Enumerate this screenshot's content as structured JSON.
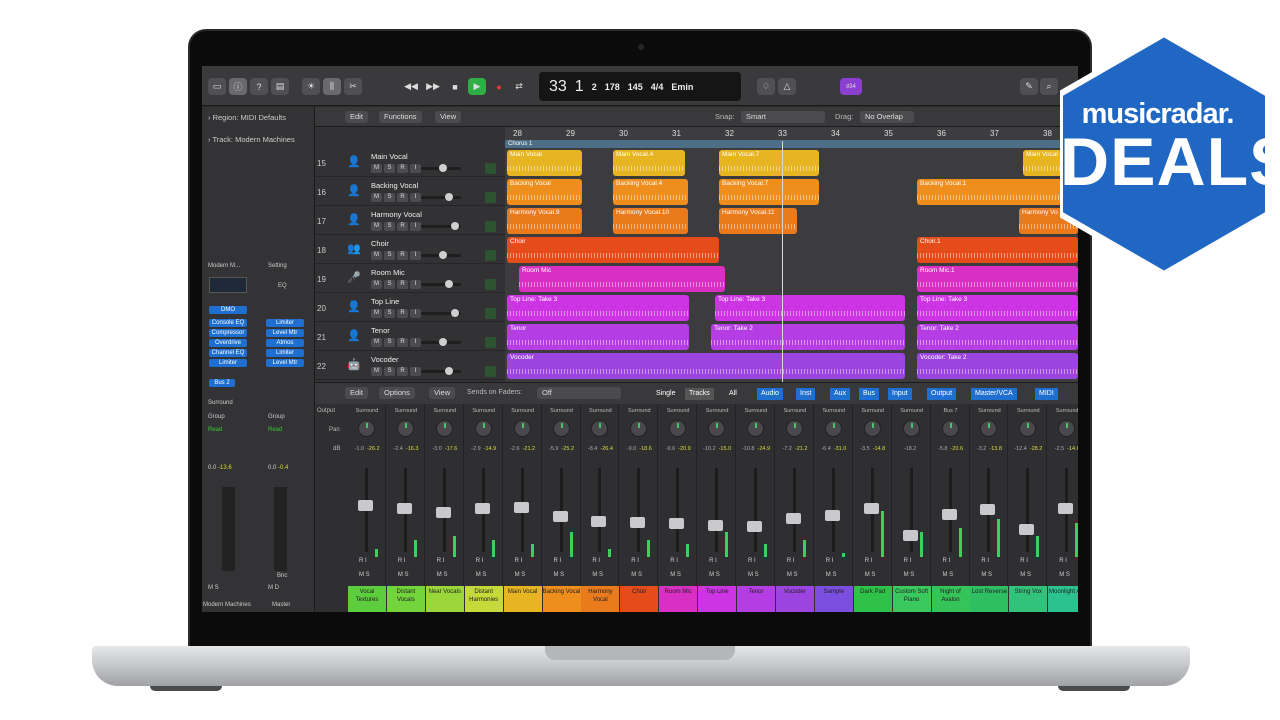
{
  "brand": {
    "site": "musicradar.",
    "label": "DEALS",
    "badge_color": "#1f67c3"
  },
  "lcd": {
    "bar": "33",
    "beat": "1",
    "div": "2",
    "tick": "178",
    "bar_lbl": "BAR",
    "beat_lbl": "BEAT",
    "div_lbl": "DIV",
    "tick_lbl": "TICK",
    "tempo": "145",
    "keep": "KEEP",
    "tempo_lbl": "TEMPO",
    "sig_top": "4",
    "sig_bot": "4",
    "time_lbl": "TIME",
    "key": "Emin",
    "key_lbl": "KEY"
  },
  "toolbar": {
    "lcd_badge": "♯34"
  },
  "inspector": {
    "region": "Region: MIDI Defaults",
    "track": "Track: Modern Machines",
    "preset": "Modern M...",
    "setting": "Setting",
    "eq": "EQ",
    "dmo": "DMO",
    "plugins_a": [
      "Console EQ",
      "Compressor",
      "Overdrive",
      "Channel EQ",
      "Limiter"
    ],
    "plugins_b": [
      "Limiter",
      "Level Mtr",
      "Atmos",
      "Limiter",
      "Level Mtr"
    ],
    "bus": "Bus 2",
    "surround": "Surround",
    "group": "Group",
    "read": "Read",
    "vals_a": [
      "0.0",
      "-13.6"
    ],
    "vals_b": [
      "0.0",
      "-0.4"
    ],
    "bnc": "Bnc",
    "names": [
      "Modern Machines",
      "Master"
    ],
    "ms": [
      "M",
      "S",
      "M",
      "D"
    ]
  },
  "tracks_header": {
    "edit": "Edit",
    "functions": "Functions",
    "view": "View",
    "snap_label": "Snap:",
    "snap": "Smart",
    "drag_label": "Drag:",
    "drag": "No Overlap"
  },
  "ruler": [
    "28",
    "29",
    "30",
    "31",
    "32",
    "33",
    "34",
    "35",
    "36",
    "37",
    "38"
  ],
  "marker": "Chorus 1",
  "tracks": [
    {
      "num": "15",
      "name": "Main Vocal",
      "icon": "👤",
      "color": "#e7b521"
    },
    {
      "num": "16",
      "name": "Backing Vocal",
      "icon": "👤",
      "color": "#ee8e1d"
    },
    {
      "num": "17",
      "name": "Harmony Vocal",
      "icon": "👤",
      "color": "#ea7b1c"
    },
    {
      "num": "18",
      "name": "Choir",
      "icon": "👥",
      "color": "#e64c1a"
    },
    {
      "num": "19",
      "name": "Room Mic",
      "icon": "🎤",
      "color": "#d92fc2"
    },
    {
      "num": "20",
      "name": "Top Line",
      "icon": "👤",
      "color": "#cc34e4"
    },
    {
      "num": "21",
      "name": "Tenor",
      "icon": "👤",
      "color": "#b43ee3"
    },
    {
      "num": "22",
      "name": "Vocoder",
      "icon": "🤖",
      "color": "#9b44e0"
    }
  ],
  "regions": [
    {
      "row": 0,
      "name": "Main Vocal",
      "color": "#e7b521"
    },
    {
      "row": 0,
      "name": "Main Vocal.4",
      "color": "#e7b521"
    },
    {
      "row": 0,
      "name": "Main Vocal.7",
      "color": "#e7b521"
    },
    {
      "row": 0,
      "name": "Main Vocal",
      "color": "#e7b521"
    },
    {
      "row": 1,
      "name": "Backing Vocal",
      "color": "#ee8e1d"
    },
    {
      "row": 1,
      "name": "Backing Vocal.4",
      "color": "#ee8e1d"
    },
    {
      "row": 1,
      "name": "Backing Vocal.7",
      "color": "#ee8e1d"
    },
    {
      "row": 1,
      "name": "Backing Vocal.1",
      "color": "#ee8e1d"
    },
    {
      "row": 2,
      "name": "Harmony Vocal.9",
      "color": "#ea7b1c"
    },
    {
      "row": 2,
      "name": "Harmony Vocal.10",
      "color": "#ea7b1c"
    },
    {
      "row": 2,
      "name": "Harmony Vocal.11",
      "color": "#ea7b1c"
    },
    {
      "row": 2,
      "name": "Harmony Vo",
      "color": "#ea7b1c"
    },
    {
      "row": 3,
      "name": "Choir",
      "color": "#e64c1a"
    },
    {
      "row": 3,
      "name": "Choir.1",
      "color": "#e64c1a"
    },
    {
      "row": 4,
      "name": "Room Mic",
      "color": "#d92fc2"
    },
    {
      "row": 4,
      "name": "Room Mic.1",
      "color": "#d92fc2"
    },
    {
      "row": 5,
      "name": "Top Line: Take 3",
      "color": "#cc34e4"
    },
    {
      "row": 5,
      "name": "Top Line: Take 3",
      "color": "#cc34e4"
    },
    {
      "row": 5,
      "name": "Top Line: Take 3",
      "color": "#cc34e4"
    },
    {
      "row": 6,
      "name": "Tenor",
      "color": "#b43ee3"
    },
    {
      "row": 6,
      "name": "Tenor: Take 2",
      "color": "#b43ee3"
    },
    {
      "row": 6,
      "name": "Tenor: Take 2",
      "color": "#b43ee3"
    },
    {
      "row": 7,
      "name": "Vocoder",
      "color": "#9b44e0"
    },
    {
      "row": 7,
      "name": "Vocoder: Take 2",
      "color": "#9b44e0"
    }
  ],
  "mixer_header": {
    "edit": "Edit",
    "options": "Options",
    "view": "View",
    "sends": "Sends on Faders:",
    "off": "Off",
    "single": "Single",
    "tracks": "Tracks",
    "all": "All",
    "filters": [
      "Audio",
      "Inst",
      "Aux",
      "Bus",
      "Input",
      "Output",
      "Master/VCA",
      "MIDI"
    ],
    "output_lbl": "Output",
    "pan_lbl": "Pan",
    "db_lbl": "dB"
  },
  "channels": [
    {
      "out": "Surround",
      "db": "-1.0",
      "peak": "-26.2",
      "name": "Vocal Textures",
      "color": "#5ccd3c",
      "level": 0.45,
      "meter": 0.1
    },
    {
      "out": "Surround",
      "db": "-2.4",
      "peak": "-16.3",
      "name": "Distant Vocals",
      "color": "#74d43b",
      "level": 0.5,
      "meter": 0.2
    },
    {
      "out": "Surround",
      "db": "-3.0",
      "peak": "-17.6",
      "name": "Near Vocals",
      "color": "#9bd63a",
      "level": 0.55,
      "meter": 0.25
    },
    {
      "out": "Surround",
      "db": "-2.9",
      "peak": "-14.9",
      "name": "Distant Harmonies",
      "color": "#c6d93a",
      "level": 0.5,
      "meter": 0.2
    },
    {
      "out": "Surround",
      "db": "-2.6",
      "peak": "-21.2",
      "name": "Main Vocal",
      "color": "#e7b521",
      "level": 0.48,
      "meter": 0.15
    },
    {
      "out": "Surround",
      "db": "-5.9",
      "peak": "-25.2",
      "name": "Backing Vocal",
      "color": "#ee8e1d",
      "level": 0.62,
      "meter": 0.3
    },
    {
      "out": "Surround",
      "db": "-8.4",
      "peak": "-26.4",
      "name": "Harmony Vocal",
      "color": "#ea7b1c",
      "level": 0.68,
      "meter": 0.1
    },
    {
      "out": "Surround",
      "db": "-9.0",
      "peak": "-18.6",
      "name": "Choir",
      "color": "#e64c1a",
      "level": 0.7,
      "meter": 0.2
    },
    {
      "out": "Surround",
      "db": "-9.6",
      "peak": "-20.9",
      "name": "Room Mic",
      "color": "#d92fc2",
      "level": 0.72,
      "meter": 0.15
    },
    {
      "out": "Surround",
      "db": "-10.2",
      "peak": "-15.0",
      "name": "Top Line",
      "color": "#cc34e4",
      "level": 0.74,
      "meter": 0.3
    },
    {
      "out": "Surround",
      "db": "-10.8",
      "peak": "-24.9",
      "name": "Tenor",
      "color": "#b43ee3",
      "level": 0.76,
      "meter": 0.15
    },
    {
      "out": "Surround",
      "db": "-7.2",
      "peak": "-21.2",
      "name": "Vocoder",
      "color": "#9b44e0",
      "level": 0.64,
      "meter": 0.2
    },
    {
      "out": "Surround",
      "db": "-6.4",
      "peak": "-31.0",
      "name": "Sample",
      "color": "#7b4ee0",
      "level": 0.6,
      "meter": 0.05
    },
    {
      "out": "Surround",
      "db": "-3.5",
      "peak": "-14.8",
      "name": "Dark Pad",
      "color": "#2ec24a",
      "level": 0.5,
      "meter": 0.55
    },
    {
      "out": "Surround",
      "db": "-18.2",
      "peak": "",
      "name": "Custom Soft Piano",
      "color": "#3ac95e",
      "level": 0.88,
      "meter": 0.3
    },
    {
      "out": "Bus 7",
      "db": "-5.8",
      "peak": "-20.6",
      "name": "Night of Avalon",
      "color": "#35c45a",
      "level": 0.58,
      "meter": 0.35
    },
    {
      "out": "Surround",
      "db": "-3.2",
      "peak": "-13.8",
      "name": "Lost Reverse",
      "color": "#2fbf63",
      "level": 0.52,
      "meter": 0.45
    },
    {
      "out": "Surround",
      "db": "-12.4",
      "peak": "-28.2",
      "name": "String Vox",
      "color": "#33c27a",
      "level": 0.8,
      "meter": 0.25
    },
    {
      "out": "Surround",
      "db": "-2.5",
      "peak": "-14.6",
      "name": "Moonlight Ark",
      "color": "#2cc290",
      "level": 0.5,
      "meter": 0.4
    }
  ],
  "strip_ctrl": {
    "ri": "R I",
    "ms": "M S"
  }
}
